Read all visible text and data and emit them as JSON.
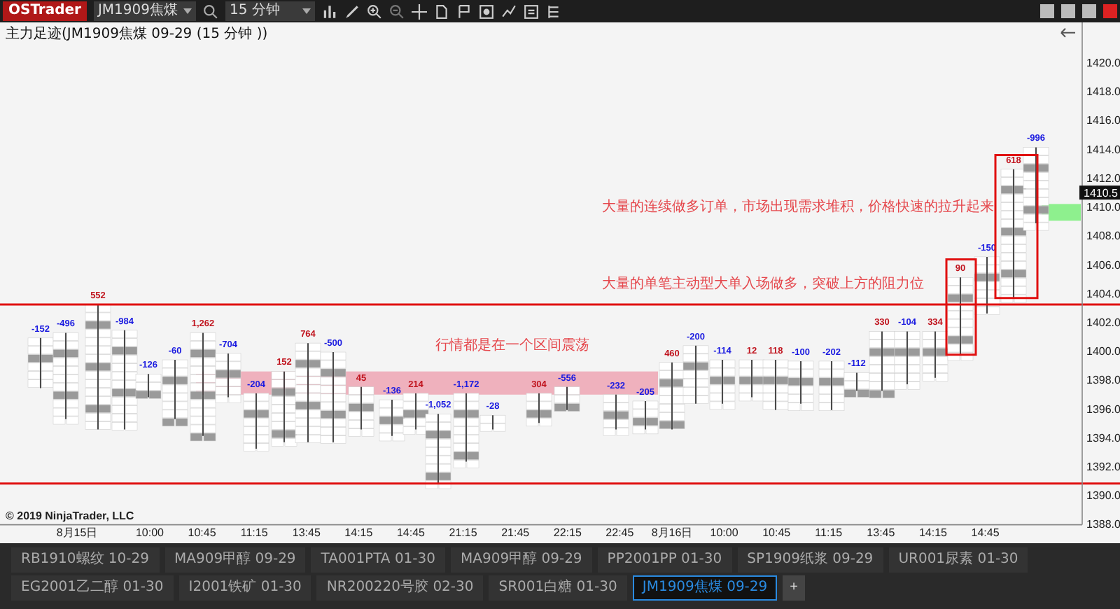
{
  "toolbar": {
    "logo": "OSTrader",
    "instrument": "JM1909焦煤",
    "interval": "15 分钟"
  },
  "chart": {
    "title": "主力足迹(JM1909焦煤 09-29 (15 分钟 ))",
    "annotations": [
      {
        "text": "大量的连续做多订单，市场出现需求堆积，价格快速的拉升起来"
      },
      {
        "text": "大量的单笔主动型大单入场做多，突破上方的阻力位"
      },
      {
        "text": "行情都是在一个区间震荡"
      }
    ],
    "footprint_bars": [
      {
        "delta": "-152"
      },
      {
        "delta": "-496"
      },
      {
        "delta": "552"
      },
      {
        "delta": "-984"
      },
      {
        "delta": "-126"
      },
      {
        "delta": "-60"
      },
      {
        "delta": "1,262"
      },
      {
        "delta": "-704"
      },
      {
        "delta": "-204"
      },
      {
        "delta": "152"
      },
      {
        "delta": "764"
      },
      {
        "delta": "-500"
      },
      {
        "delta": "45"
      },
      {
        "delta": "-136"
      },
      {
        "delta": "214"
      },
      {
        "delta": "-1,052"
      },
      {
        "delta": "-1,172"
      },
      {
        "delta": "-28"
      },
      {
        "delta": "304"
      },
      {
        "delta": "-556"
      },
      {
        "delta": "-232"
      },
      {
        "delta": "-205"
      },
      {
        "delta": "460"
      },
      {
        "delta": "-200"
      },
      {
        "delta": "-114"
      },
      {
        "delta": "12"
      },
      {
        "delta": "118"
      },
      {
        "delta": "-100"
      },
      {
        "delta": "-202"
      },
      {
        "delta": "-112"
      },
      {
        "delta": "330"
      },
      {
        "delta": "-104"
      },
      {
        "delta": "334"
      },
      {
        "delta": "90"
      },
      {
        "delta": "-150"
      },
      {
        "delta": "618"
      },
      {
        "delta": "-996"
      }
    ],
    "current_price": "1410.5",
    "copyright": "© 2019 NinjaTrader, LLC"
  },
  "price_axis": [
    "1420.0",
    "1418.0",
    "1416.0",
    "1414.0",
    "1412.0",
    "1410.0",
    "1408.0",
    "1406.0",
    "1404.0",
    "1402.0",
    "1400.0",
    "1398.0",
    "1396.0",
    "1394.0",
    "1392.0",
    "1390.0",
    "1388.0"
  ],
  "time_axis": [
    "8月15日",
    "10:00",
    "10:45",
    "11:15",
    "13:45",
    "14:15",
    "14:45",
    "21:15",
    "21:45",
    "22:15",
    "22:45",
    "8月16日",
    "10:00",
    "10:45",
    "11:15",
    "13:45",
    "14:15",
    "14:45"
  ],
  "tabs": [
    {
      "label": "RB1910螺纹 10-29",
      "selected": false
    },
    {
      "label": "MA909甲醇 09-29",
      "selected": false
    },
    {
      "label": "TA001PTA 01-30",
      "selected": false
    },
    {
      "label": "MA909甲醇 09-29",
      "selected": false
    },
    {
      "label": "PP2001PP 01-30",
      "selected": false
    },
    {
      "label": "SP1909纸浆 09-29",
      "selected": false
    },
    {
      "label": "UR001尿素 01-30",
      "selected": false
    },
    {
      "label": "EG2001乙二醇 01-30",
      "selected": false
    },
    {
      "label": "I2001铁矿 01-30",
      "selected": false
    },
    {
      "label": "NR200220号胶 02-30",
      "selected": false
    },
    {
      "label": "SR001白糖 01-30",
      "selected": false
    },
    {
      "label": "JM1909焦煤 09-29",
      "selected": true
    }
  ],
  "add_tab": "+"
}
